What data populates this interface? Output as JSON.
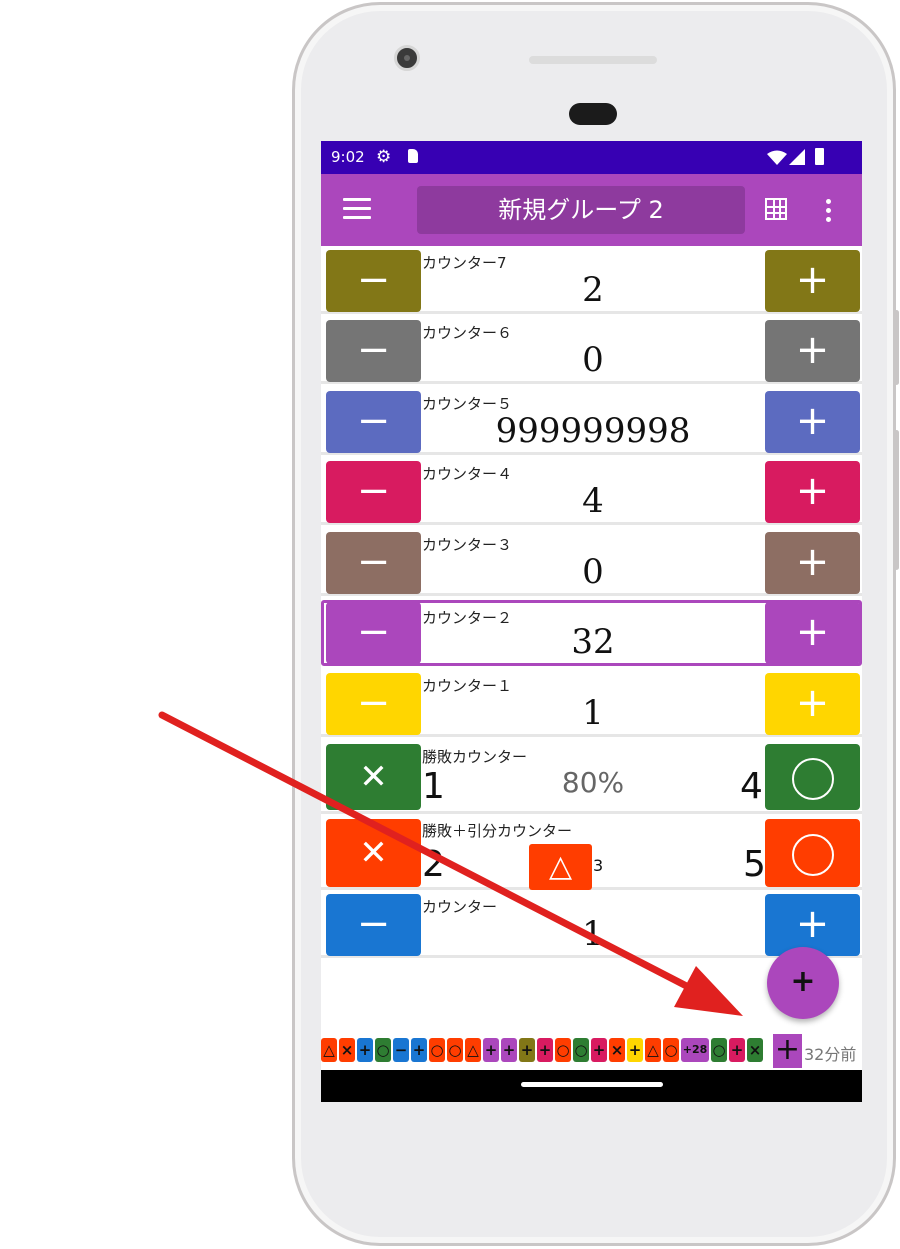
{
  "status_bar": {
    "time": "9:02"
  },
  "app_bar": {
    "group_title": "新規グループ 2"
  },
  "counters": [
    {
      "label": "カウンター7",
      "value": "2",
      "color": "#827717"
    },
    {
      "label": "カウンター６",
      "value": "0",
      "color": "#757575"
    },
    {
      "label": "カウンター５",
      "value": "999999998",
      "color": "#5c6bc0"
    },
    {
      "label": "カウンター４",
      "value": "4",
      "color": "#d81b60"
    },
    {
      "label": "カウンター３",
      "value": "0",
      "color": "#8d6e63"
    },
    {
      "label": "カウンター２",
      "value": "32",
      "color": "#ab47bc"
    },
    {
      "label": "カウンター１",
      "value": "1",
      "color": "#ffd600"
    }
  ],
  "win_loss": {
    "label": "勝敗カウンター",
    "losses": "1",
    "rate": "80%",
    "wins": "4",
    "color": "#2e7d32"
  },
  "win_loss_draw": {
    "label": "勝敗＋引分カウンター",
    "losses": "2",
    "draws": "3",
    "wins": "5",
    "color": "#ff3d00"
  },
  "counter_plain": {
    "label": "カウンター",
    "value": "1",
    "color": "#1976d2"
  },
  "buttons": {
    "minus": "−",
    "plus": "+",
    "lose": "✕",
    "draw": "△",
    "fab": "+"
  },
  "history": {
    "chips": [
      {
        "text": "△",
        "color": "#ff3d00"
      },
      {
        "text": "×",
        "color": "#ff3d00"
      },
      {
        "text": "+",
        "color": "#1976d2"
      },
      {
        "text": "○",
        "color": "#2e7d32"
      },
      {
        "text": "−",
        "color": "#1976d2"
      },
      {
        "text": "+",
        "color": "#1976d2"
      },
      {
        "text": "○",
        "color": "#ff3d00"
      },
      {
        "text": "○",
        "color": "#ff3d00"
      },
      {
        "text": "△",
        "color": "#ff3d00"
      },
      {
        "text": "+",
        "color": "#ab47bc"
      },
      {
        "text": "+",
        "color": "#ab47bc"
      },
      {
        "text": "+",
        "color": "#827717"
      },
      {
        "text": "+",
        "color": "#d81b60"
      },
      {
        "text": "○",
        "color": "#ff3d00"
      },
      {
        "text": "○",
        "color": "#2e7d32"
      },
      {
        "text": "+",
        "color": "#d81b60"
      },
      {
        "text": "×",
        "color": "#ff3d00"
      },
      {
        "text": "+",
        "color": "#ffd600"
      },
      {
        "text": "△",
        "color": "#ff3d00"
      },
      {
        "text": "○",
        "color": "#ff3d00"
      },
      {
        "text": "+28",
        "color": "#ab47bc"
      },
      {
        "text": "○",
        "color": "#2e7d32"
      },
      {
        "text": "+",
        "color": "#d81b60"
      },
      {
        "text": "×",
        "color": "#2e7d32"
      }
    ],
    "add_button": "+",
    "time_ago": "32分前"
  }
}
